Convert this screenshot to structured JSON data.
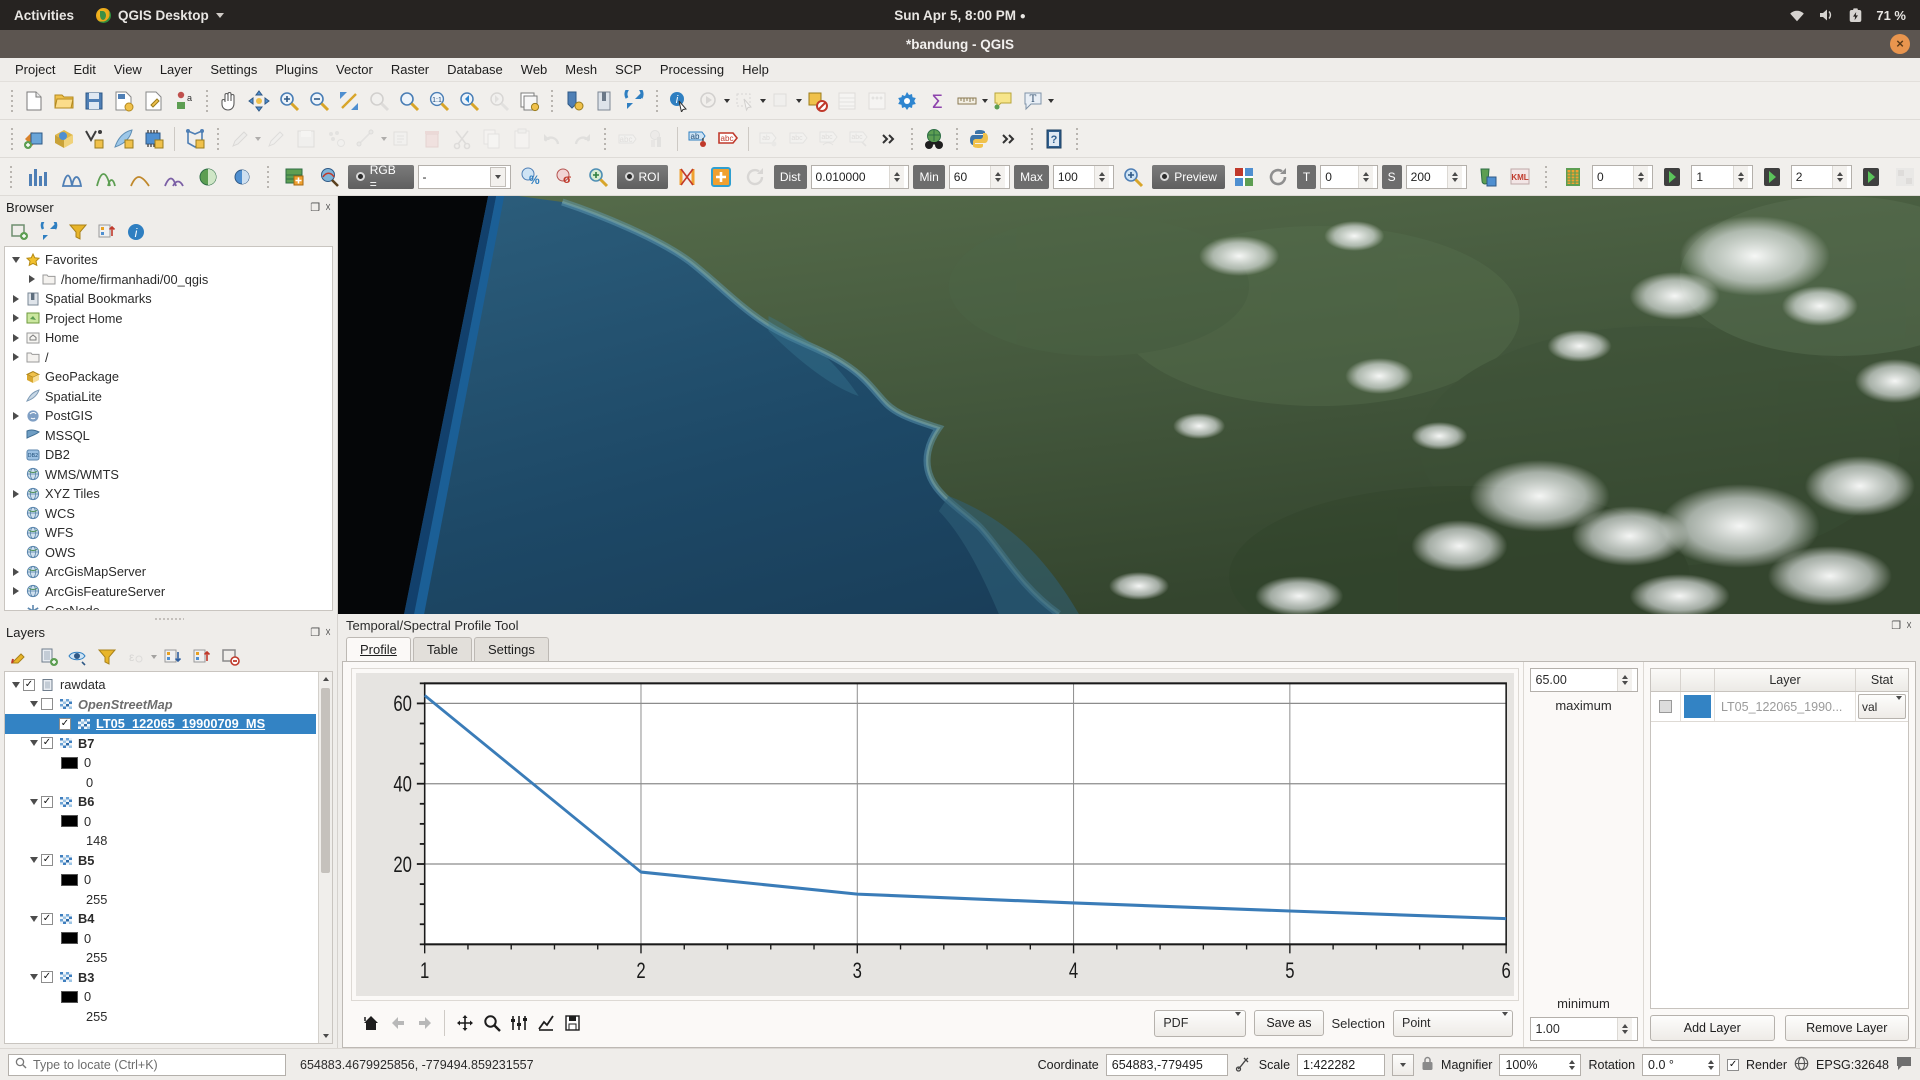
{
  "gnome": {
    "activities": "Activities",
    "app_name": "QGIS Desktop",
    "clock": "Sun Apr  5, 8:00 PM",
    "battery": "71 %"
  },
  "window": {
    "title": "*bandung - QGIS",
    "close_glyph": "×"
  },
  "menubar": [
    "Project",
    "Edit",
    "View",
    "Layer",
    "Settings",
    "Plugins",
    "Vector",
    "Raster",
    "Database",
    "Web",
    "Mesh",
    "SCP",
    "Processing",
    "Help"
  ],
  "raster_toolbar": {
    "rgb_label": "RGB =",
    "rgb_value": "-",
    "roi_label": "ROI",
    "dist_label": "Dist",
    "dist_value": "0.010000",
    "min_label": "Min",
    "min_value": "60",
    "max_label": "Max",
    "max_value": "100",
    "preview_label": "Preview",
    "t_label": "T",
    "t_value": "0",
    "s_label": "S",
    "s_value": "200",
    "kml_label": "KML",
    "band_value": "0",
    "band_value_2": "1",
    "band_value_3": "2"
  },
  "browser": {
    "title": "Browser",
    "items": [
      {
        "label": "Favorites",
        "icon": "star-icon",
        "expander": "down",
        "indent": 0
      },
      {
        "label": "/home/firmanhadi/00_qgis",
        "icon": "folder-icon",
        "expander": "right",
        "indent": 1
      },
      {
        "label": "Spatial Bookmarks",
        "icon": "bookmark-icon",
        "expander": "right",
        "indent": 0
      },
      {
        "label": "Project Home",
        "icon": "project-home-icon",
        "expander": "right",
        "indent": 0
      },
      {
        "label": "Home",
        "icon": "home-icon",
        "expander": "right",
        "indent": 0
      },
      {
        "label": "/",
        "icon": "folder-icon",
        "expander": "right",
        "indent": 0
      },
      {
        "label": "GeoPackage",
        "icon": "geopackage-icon",
        "expander": "none",
        "indent": 0
      },
      {
        "label": "SpatiaLite",
        "icon": "spatialite-icon",
        "expander": "none",
        "indent": 0
      },
      {
        "label": "PostGIS",
        "icon": "postgis-icon",
        "expander": "right",
        "indent": 0
      },
      {
        "label": "MSSQL",
        "icon": "mssql-icon",
        "expander": "none",
        "indent": 0
      },
      {
        "label": "DB2",
        "icon": "db2-icon",
        "expander": "none",
        "indent": 0
      },
      {
        "label": "WMS/WMTS",
        "icon": "globe-icon",
        "expander": "none",
        "indent": 0
      },
      {
        "label": "XYZ Tiles",
        "icon": "globe-icon",
        "expander": "right",
        "indent": 0
      },
      {
        "label": "WCS",
        "icon": "globe-icon",
        "expander": "none",
        "indent": 0
      },
      {
        "label": "WFS",
        "icon": "globe-icon",
        "expander": "none",
        "indent": 0
      },
      {
        "label": "OWS",
        "icon": "globe-icon",
        "expander": "none",
        "indent": 0
      },
      {
        "label": "ArcGisMapServer",
        "icon": "globe-icon",
        "expander": "right",
        "indent": 0
      },
      {
        "label": "ArcGisFeatureServer",
        "icon": "globe-icon",
        "expander": "right",
        "indent": 0
      },
      {
        "label": "GeoNode",
        "icon": "geonode-icon",
        "expander": "none",
        "indent": 0
      }
    ]
  },
  "layers": {
    "title": "Layers",
    "items": [
      {
        "label": "rawdata",
        "kind": "group",
        "checked": true,
        "expander": "down",
        "indent": 0
      },
      {
        "label": "OpenStreetMap",
        "kind": "raster-italic",
        "checked": false,
        "expander": "down",
        "indent": 1
      },
      {
        "label": "LT05_122065_19900709_MS",
        "kind": "raster-selected",
        "checked": true,
        "expander": "none",
        "indent": 2
      },
      {
        "label": "B7",
        "kind": "band",
        "checked": true,
        "expander": "down",
        "indent": 1
      },
      {
        "label": "0",
        "kind": "swatch",
        "indent": 2
      },
      {
        "label": "0",
        "kind": "value",
        "indent": 2
      },
      {
        "label": "B6",
        "kind": "band",
        "checked": true,
        "expander": "down",
        "indent": 1
      },
      {
        "label": "0",
        "kind": "swatch",
        "indent": 2
      },
      {
        "label": "148",
        "kind": "value",
        "indent": 2
      },
      {
        "label": "B5",
        "kind": "band",
        "checked": true,
        "expander": "down",
        "indent": 1
      },
      {
        "label": "0",
        "kind": "swatch",
        "indent": 2
      },
      {
        "label": "255",
        "kind": "value",
        "indent": 2
      },
      {
        "label": "B4",
        "kind": "band",
        "checked": true,
        "expander": "down",
        "indent": 1
      },
      {
        "label": "0",
        "kind": "swatch",
        "indent": 2
      },
      {
        "label": "255",
        "kind": "value",
        "indent": 2
      },
      {
        "label": "B3",
        "kind": "band",
        "checked": true,
        "expander": "down",
        "indent": 1
      },
      {
        "label": "0",
        "kind": "swatch",
        "indent": 2
      },
      {
        "label": "255",
        "kind": "value",
        "indent": 2
      }
    ]
  },
  "profile_panel": {
    "title": "Temporal/Spectral Profile Tool",
    "tabs": [
      {
        "label": "Profile",
        "active": true
      },
      {
        "label": "Table",
        "active": false
      },
      {
        "label": "Settings",
        "active": false
      }
    ],
    "maximum_label": "maximum",
    "maximum_value": "65.00",
    "minimum_label": "minimum",
    "minimum_value": "1.00",
    "export_format": "PDF",
    "save_as_label": "Save as",
    "selection_label": "Selection",
    "selection_value": "Point",
    "add_layer_label": "Add Layer",
    "remove_layer_label": "Remove Layer",
    "layer_table": {
      "headers": [
        "",
        "",
        "Layer",
        "Stat"
      ],
      "rows": [
        {
          "checked": false,
          "color": "#3383c4",
          "layer": "LT05_122065_1990...",
          "stat": "val"
        }
      ]
    },
    "mpl_buttons": [
      "home-icon",
      "back-arrow-icon",
      "forward-arrow-icon",
      "pan-icon",
      "zoom-rect-icon",
      "configure-subplots-icon",
      "edit-curves-icon",
      "save-figure-icon"
    ]
  },
  "chart_data": {
    "type": "line",
    "title": "",
    "xlabel": "",
    "ylabel": "",
    "x": [
      1,
      2,
      3,
      4,
      5,
      6
    ],
    "series": [
      {
        "name": "LT05_122065_19900709_MS",
        "color": "#3a7cb8",
        "values": [
          62,
          18,
          12.5,
          10.3,
          8.3,
          6.4
        ]
      }
    ],
    "xticks": [
      "1",
      "2",
      "3",
      "4",
      "5",
      "6"
    ],
    "yticks": [
      "20",
      "40",
      "60"
    ],
    "xlim": [
      1,
      6
    ],
    "ylim": [
      0,
      65
    ],
    "grid": true,
    "legend": "none"
  },
  "statusbar": {
    "locate_placeholder": "Type to locate (Ctrl+K)",
    "cursor_coords": "654883.4679925856, -779494.859231557",
    "coordinate_label": "Coordinate",
    "coordinate_value": "654883,-779495",
    "scale_label": "Scale",
    "scale_value": "1:422282",
    "magnifier_label": "Magnifier",
    "magnifier_value": "100%",
    "rotation_label": "Rotation",
    "rotation_value": "0.0 °",
    "render_label": "Render",
    "epsg_label": "EPSG:32648"
  },
  "colors": {
    "accent": "#3383c4",
    "line": "#3a7cb8",
    "titlebar": "#5c5550",
    "topbar": "#262321",
    "chrome": "#efedea"
  }
}
